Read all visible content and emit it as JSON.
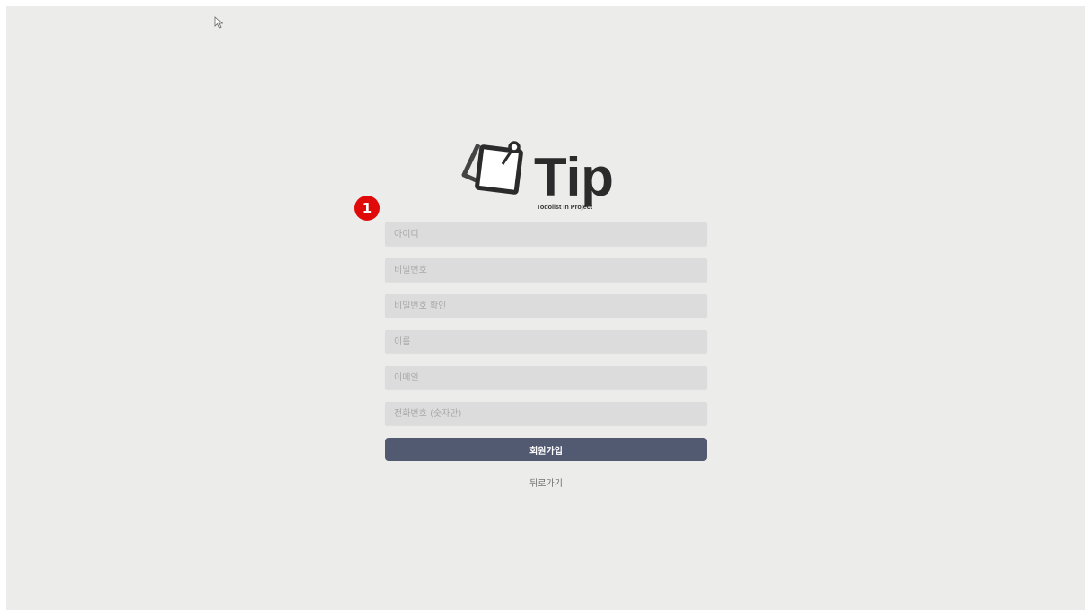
{
  "logo": {
    "wordmark": "Tip",
    "tagline": "Todolist In Project"
  },
  "badge": {
    "label": "1",
    "color": "#e10a0a"
  },
  "form": {
    "username_placeholder": "아이디",
    "password_placeholder": "비밀번호",
    "password_confirm_placeholder": "비밀번호 확인",
    "name_placeholder": "이름",
    "email_placeholder": "이메일",
    "phone_placeholder": "전화번호 (숫자만)",
    "submit_label": "회원가입",
    "back_label": "뒤로가기"
  },
  "colors": {
    "background": "#ececeb",
    "field_background": "#dcdcdc",
    "button_background": "#525a72",
    "logo_dark": "#2b2b2b"
  },
  "icons": {
    "cursor": "arrow-cursor-icon",
    "logo_mark": "sticky-notes-icon"
  }
}
